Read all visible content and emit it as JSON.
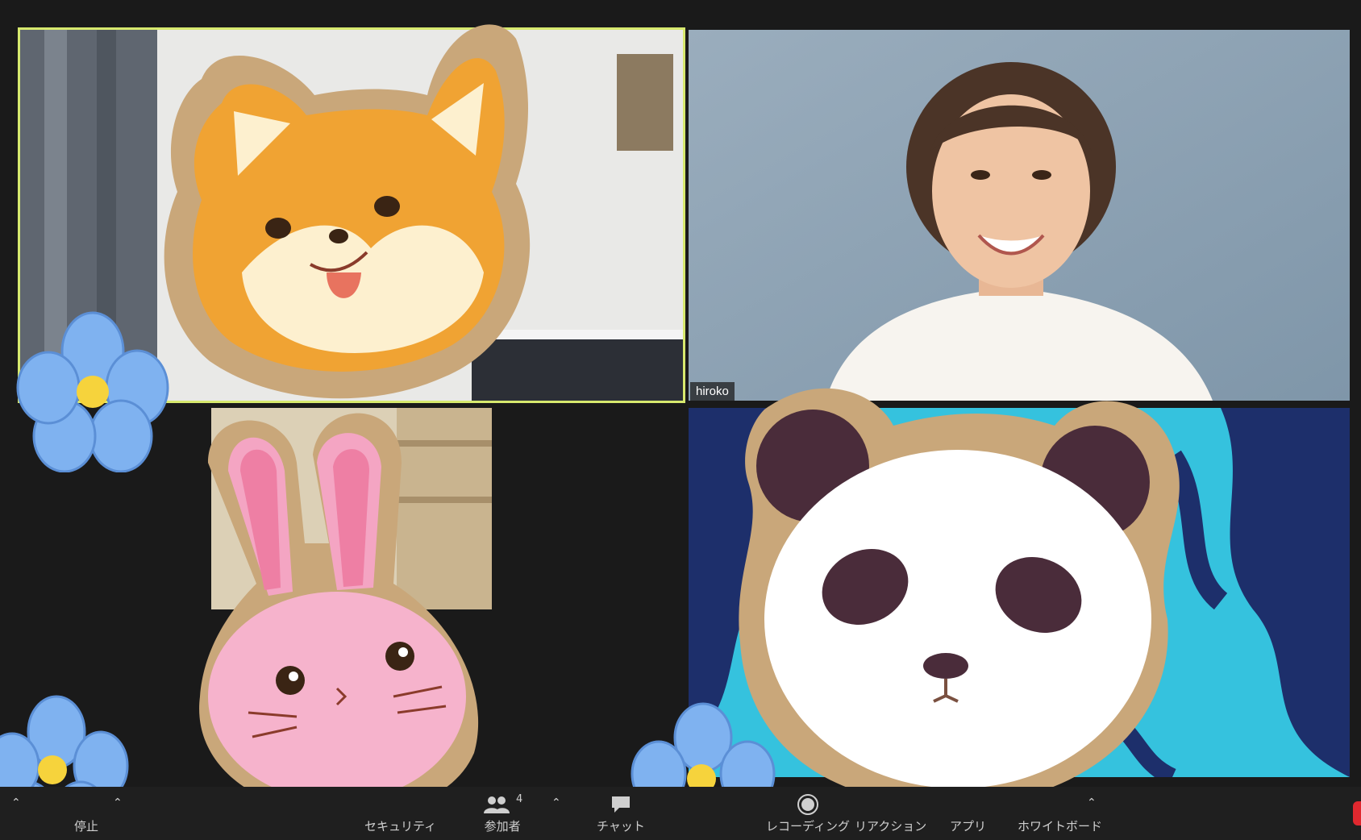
{
  "participants": [
    {
      "name": ""
    },
    {
      "name": "hiroko"
    },
    {
      "name": ""
    },
    {
      "name": ""
    }
  ],
  "toolbar": {
    "video_stop_label": "停止",
    "security_label": "セキュリティ",
    "participants_label": "参加者",
    "participants_count": "4",
    "chat_label": "チャット",
    "recording_label": "レコーディング",
    "reactions_label": "リアクション",
    "apps_label": "アプリ",
    "whiteboard_label": "ホワイトボード"
  },
  "colors": {
    "active_speaker_border": "#d7e96e",
    "flower": "#7fb2f0",
    "cookie": "#c9a77a"
  },
  "icons": [
    "participants-icon",
    "chat-icon",
    "record-icon",
    "caret-up-icon"
  ]
}
